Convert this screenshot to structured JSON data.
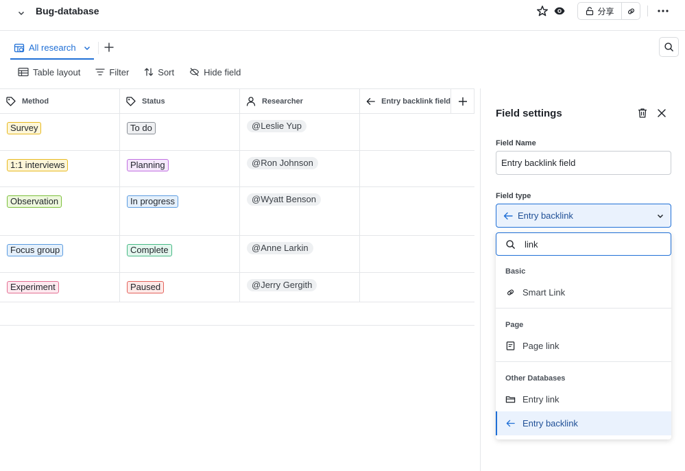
{
  "topbar": {
    "title": "Bug-database",
    "share_label": "分享"
  },
  "views": {
    "active_tab": "All research"
  },
  "toolbar": {
    "table_layout": "Table layout",
    "filter": "Filter",
    "sort": "Sort",
    "hide_field": "Hide field"
  },
  "table": {
    "columns": [
      "Method",
      "Status",
      "Researcher",
      "Entry backlink field"
    ],
    "rows": [
      {
        "method": "Survey",
        "status": "To do",
        "researcher": "@Leslie Yup"
      },
      {
        "method": "1:1 interviews",
        "status": "Planning",
        "researcher": "@Ron Johnson"
      },
      {
        "method": "Observation",
        "status": "In progress",
        "researcher": "@Wyatt Benson"
      },
      {
        "method": "Focus group",
        "status": "Complete",
        "researcher": "@Anne Larkin"
      },
      {
        "method": "Experiment",
        "status": "Paused",
        "researcher": "@Jerry Gergith"
      }
    ]
  },
  "panel": {
    "title": "Field settings",
    "field_name_label": "Field Name",
    "field_name_value": "Entry backlink field",
    "field_type_label": "Field type",
    "field_type_value": "Entry backlink",
    "search_value": "link",
    "groups": [
      {
        "label": "Basic",
        "items": [
          {
            "label": "Smart Link"
          }
        ]
      },
      {
        "label": "Page",
        "items": [
          {
            "label": "Page link"
          }
        ]
      },
      {
        "label": "Other Databases",
        "items": [
          {
            "label": "Entry link"
          },
          {
            "label": "Entry backlink"
          }
        ]
      }
    ]
  },
  "colors": {
    "accent": "#1f6fd6",
    "selected_bg": "#eaf2fd",
    "tag_yellow_bg": "#fdf6d8",
    "tag_yellow_border": "#e8b91f",
    "tag_green_bg": "#eef8de",
    "tag_green_border": "#7cbf3a",
    "tag_blue_bg": "#e5f0fb",
    "tag_blue_border": "#5a9be0",
    "tag_pink_bg": "#fde9ef",
    "tag_pink_border": "#e46e92",
    "tag_gray_bg": "#eff0f2",
    "tag_gray_border": "#8a8f96",
    "tag_purple_bg": "#f6e9fc",
    "tag_purple_border": "#c06ee0",
    "tag_teal_bg": "#e3f7ee",
    "tag_teal_border": "#46b884",
    "tag_red_bg": "#fde9e7",
    "tag_red_border": "#e4615a"
  }
}
